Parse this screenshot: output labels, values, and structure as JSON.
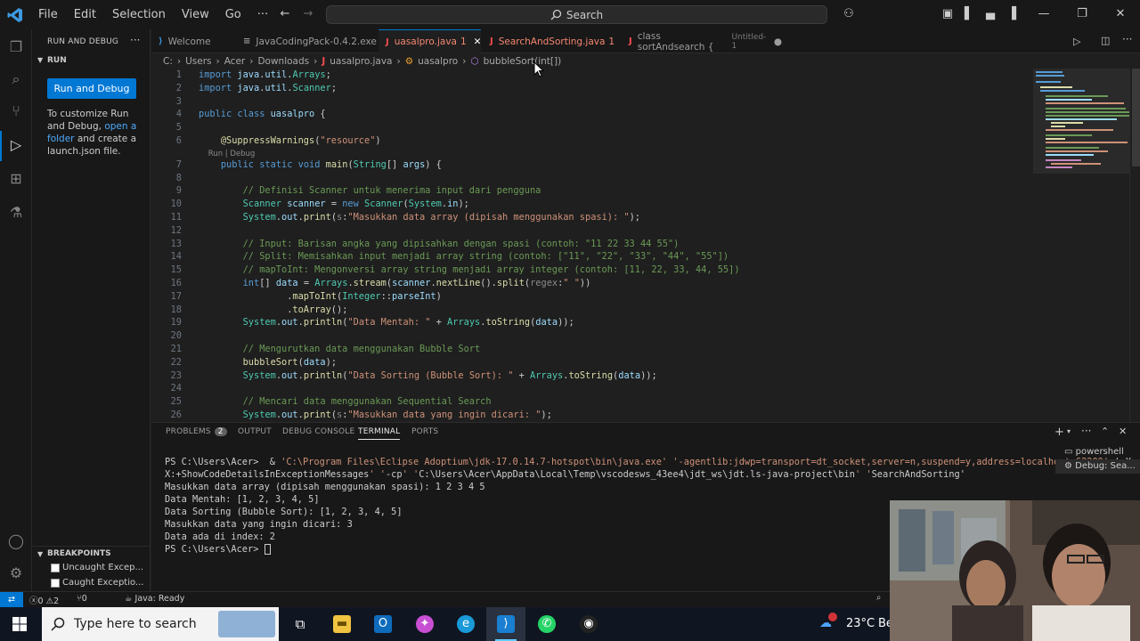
{
  "menu": [
    "File",
    "Edit",
    "Selection",
    "View",
    "Go",
    "···"
  ],
  "search_label": "Search",
  "sidebar": {
    "title": "RUN AND DEBUG",
    "section": "RUN",
    "run_button": "Run and Debug",
    "help_pre": "To customize Run and Debug,",
    "help_link": "open a folder",
    "help_post": "and create a launch.json file.",
    "breakpoints_title": "BREAKPOINTS",
    "breakpoints": [
      "Uncaught Excep...",
      "Caught Exceptio..."
    ]
  },
  "tabs": [
    {
      "label": "Welcome",
      "badge": ""
    },
    {
      "label": "JavaCodingPack-0.4.2.exe",
      "badge": ""
    },
    {
      "label": "uasalpro.java",
      "badge": "1"
    },
    {
      "label": "SearchAndSorting.java",
      "badge": "1"
    },
    {
      "label": "class sortAndsearch {",
      "badge": "Untitled-1"
    }
  ],
  "breadcrumb": [
    "C:",
    "Users",
    "Acer",
    "Downloads",
    "uasalpro.java",
    "uasalpro",
    "bubbleSort(int[])"
  ],
  "code_lines": [
    {
      "n": "1",
      "t": "import java.util.Arrays;"
    },
    {
      "n": "2",
      "t": "import java.util.Scanner;"
    },
    {
      "n": "3",
      "t": ""
    },
    {
      "n": "4",
      "t": "public class uasalpro {"
    },
    {
      "n": "5",
      "t": ""
    },
    {
      "n": "6",
      "t": "    @SuppressWarnings(\"resource\")"
    },
    {
      "n": "",
      "t": "    Run | Debug"
    },
    {
      "n": "7",
      "t": "    public static void main(String[] args) {"
    },
    {
      "n": "8",
      "t": ""
    },
    {
      "n": "9",
      "t": "        // Definisi Scanner untuk menerima input dari pengguna"
    },
    {
      "n": "10",
      "t": "        Scanner scanner = new Scanner(System.in);"
    },
    {
      "n": "11",
      "t": "        System.out.print(s:\"Masukkan data array (dipisah menggunakan spasi): \");"
    },
    {
      "n": "12",
      "t": ""
    },
    {
      "n": "13",
      "t": "        // Input: Barisan angka yang dipisahkan dengan spasi (contoh: \"11 22 33 44 55\")"
    },
    {
      "n": "14",
      "t": "        // Split: Memisahkan input menjadi array string (contoh: [\"11\", \"22\", \"33\", \"44\", \"55\"])"
    },
    {
      "n": "15",
      "t": "        // mapToInt: Mengonversi array string menjadi array integer (contoh: [11, 22, 33, 44, 55])"
    },
    {
      "n": "16",
      "t": "        int[] data = Arrays.stream(scanner.nextLine().split(regex:\" \"))"
    },
    {
      "n": "17",
      "t": "                .mapToInt(Integer::parseInt)"
    },
    {
      "n": "18",
      "t": "                .toArray();"
    },
    {
      "n": "19",
      "t": "        System.out.println(\"Data Mentah: \" + Arrays.toString(data));"
    },
    {
      "n": "20",
      "t": ""
    },
    {
      "n": "21",
      "t": "        // Mengurutkan data menggunakan Bubble Sort"
    },
    {
      "n": "22",
      "t": "        bubbleSort(data);"
    },
    {
      "n": "23",
      "t": "        System.out.println(\"Data Sorting (Bubble Sort): \" + Arrays.toString(data));"
    },
    {
      "n": "24",
      "t": ""
    },
    {
      "n": "25",
      "t": "        // Mencari data menggunakan Sequential Search"
    },
    {
      "n": "26",
      "t": "        System.out.print(s:\"Masukkan data yang ingin dicari: \");"
    }
  ],
  "panel": {
    "tabs": [
      "PROBLEMS",
      "OUTPUT",
      "DEBUG CONSOLE",
      "TERMINAL",
      "PORTS"
    ],
    "problems_count": "2",
    "terminal_lines": [
      "PS C:\\Users\\Acer>  & 'C:\\Program Files\\Eclipse Adoptium\\jdk-17.0.14.7-hotspot\\bin\\java.exe' '-agentlib:jdwp=transport=dt_socket,server=n,suspend=y,address=localhost:62209' '-X",
      "X:+ShowCodeDetailsInExceptionMessages' '-cp' 'C:\\Users\\Acer\\AppData\\Local\\Temp\\vscodesws_43ee4\\jdt_ws\\jdt.ls-java-project\\bin' 'SearchAndSorting'",
      "Masukkan data array (dipisah menggunakan spasi): 1 2 3 4 5",
      "Data Mentah: [1, 2, 3, 4, 5]",
      "Data Sorting (Bubble Sort): [1, 2, 3, 4, 5]",
      "Masukkan data yang ingin dicari: 3",
      "Data ada di index: 2",
      "PS C:\\Users\\Acer> "
    ],
    "terminals": [
      "powershell",
      "Debug: Sea..."
    ]
  },
  "statusbar": {
    "errors": "0",
    "warnings": "2",
    "ports": "0",
    "java": "Java: Ready"
  },
  "taskbar": {
    "search_placeholder": "Type here to search",
    "weather": "23°C",
    "weather_cut": "Be"
  },
  "colors": {
    "accent": "#0078d4",
    "editor_bg": "#1f1f1f",
    "chrome_bg": "#181818"
  }
}
